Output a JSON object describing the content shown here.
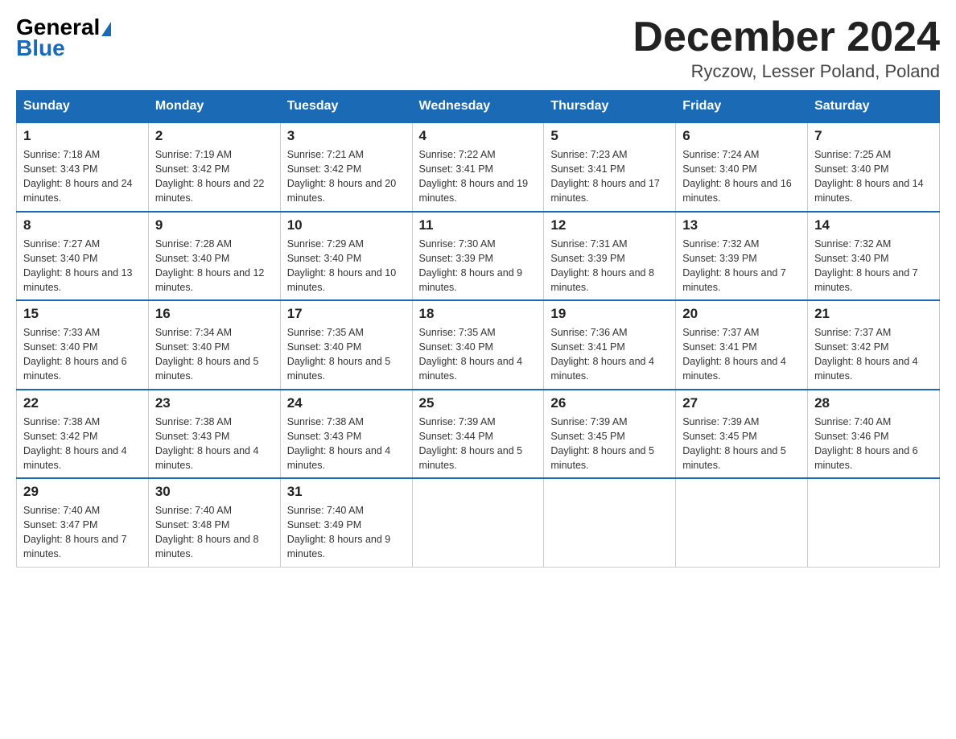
{
  "header": {
    "logo_text_general": "General",
    "logo_text_blue": "Blue",
    "month_title": "December 2024",
    "location": "Ryczow, Lesser Poland, Poland"
  },
  "weekdays": [
    "Sunday",
    "Monday",
    "Tuesday",
    "Wednesday",
    "Thursday",
    "Friday",
    "Saturday"
  ],
  "weeks": [
    [
      {
        "day": "1",
        "sunrise": "7:18 AM",
        "sunset": "3:43 PM",
        "daylight": "8 hours and 24 minutes."
      },
      {
        "day": "2",
        "sunrise": "7:19 AM",
        "sunset": "3:42 PM",
        "daylight": "8 hours and 22 minutes."
      },
      {
        "day": "3",
        "sunrise": "7:21 AM",
        "sunset": "3:42 PM",
        "daylight": "8 hours and 20 minutes."
      },
      {
        "day": "4",
        "sunrise": "7:22 AM",
        "sunset": "3:41 PM",
        "daylight": "8 hours and 19 minutes."
      },
      {
        "day": "5",
        "sunrise": "7:23 AM",
        "sunset": "3:41 PM",
        "daylight": "8 hours and 17 minutes."
      },
      {
        "day": "6",
        "sunrise": "7:24 AM",
        "sunset": "3:40 PM",
        "daylight": "8 hours and 16 minutes."
      },
      {
        "day": "7",
        "sunrise": "7:25 AM",
        "sunset": "3:40 PM",
        "daylight": "8 hours and 14 minutes."
      }
    ],
    [
      {
        "day": "8",
        "sunrise": "7:27 AM",
        "sunset": "3:40 PM",
        "daylight": "8 hours and 13 minutes."
      },
      {
        "day": "9",
        "sunrise": "7:28 AM",
        "sunset": "3:40 PM",
        "daylight": "8 hours and 12 minutes."
      },
      {
        "day": "10",
        "sunrise": "7:29 AM",
        "sunset": "3:40 PM",
        "daylight": "8 hours and 10 minutes."
      },
      {
        "day": "11",
        "sunrise": "7:30 AM",
        "sunset": "3:39 PM",
        "daylight": "8 hours and 9 minutes."
      },
      {
        "day": "12",
        "sunrise": "7:31 AM",
        "sunset": "3:39 PM",
        "daylight": "8 hours and 8 minutes."
      },
      {
        "day": "13",
        "sunrise": "7:32 AM",
        "sunset": "3:39 PM",
        "daylight": "8 hours and 7 minutes."
      },
      {
        "day": "14",
        "sunrise": "7:32 AM",
        "sunset": "3:40 PM",
        "daylight": "8 hours and 7 minutes."
      }
    ],
    [
      {
        "day": "15",
        "sunrise": "7:33 AM",
        "sunset": "3:40 PM",
        "daylight": "8 hours and 6 minutes."
      },
      {
        "day": "16",
        "sunrise": "7:34 AM",
        "sunset": "3:40 PM",
        "daylight": "8 hours and 5 minutes."
      },
      {
        "day": "17",
        "sunrise": "7:35 AM",
        "sunset": "3:40 PM",
        "daylight": "8 hours and 5 minutes."
      },
      {
        "day": "18",
        "sunrise": "7:35 AM",
        "sunset": "3:40 PM",
        "daylight": "8 hours and 4 minutes."
      },
      {
        "day": "19",
        "sunrise": "7:36 AM",
        "sunset": "3:41 PM",
        "daylight": "8 hours and 4 minutes."
      },
      {
        "day": "20",
        "sunrise": "7:37 AM",
        "sunset": "3:41 PM",
        "daylight": "8 hours and 4 minutes."
      },
      {
        "day": "21",
        "sunrise": "7:37 AM",
        "sunset": "3:42 PM",
        "daylight": "8 hours and 4 minutes."
      }
    ],
    [
      {
        "day": "22",
        "sunrise": "7:38 AM",
        "sunset": "3:42 PM",
        "daylight": "8 hours and 4 minutes."
      },
      {
        "day": "23",
        "sunrise": "7:38 AM",
        "sunset": "3:43 PM",
        "daylight": "8 hours and 4 minutes."
      },
      {
        "day": "24",
        "sunrise": "7:38 AM",
        "sunset": "3:43 PM",
        "daylight": "8 hours and 4 minutes."
      },
      {
        "day": "25",
        "sunrise": "7:39 AM",
        "sunset": "3:44 PM",
        "daylight": "8 hours and 5 minutes."
      },
      {
        "day": "26",
        "sunrise": "7:39 AM",
        "sunset": "3:45 PM",
        "daylight": "8 hours and 5 minutes."
      },
      {
        "day": "27",
        "sunrise": "7:39 AM",
        "sunset": "3:45 PM",
        "daylight": "8 hours and 5 minutes."
      },
      {
        "day": "28",
        "sunrise": "7:40 AM",
        "sunset": "3:46 PM",
        "daylight": "8 hours and 6 minutes."
      }
    ],
    [
      {
        "day": "29",
        "sunrise": "7:40 AM",
        "sunset": "3:47 PM",
        "daylight": "8 hours and 7 minutes."
      },
      {
        "day": "30",
        "sunrise": "7:40 AM",
        "sunset": "3:48 PM",
        "daylight": "8 hours and 8 minutes."
      },
      {
        "day": "31",
        "sunrise": "7:40 AM",
        "sunset": "3:49 PM",
        "daylight": "8 hours and 9 minutes."
      },
      null,
      null,
      null,
      null
    ]
  ]
}
